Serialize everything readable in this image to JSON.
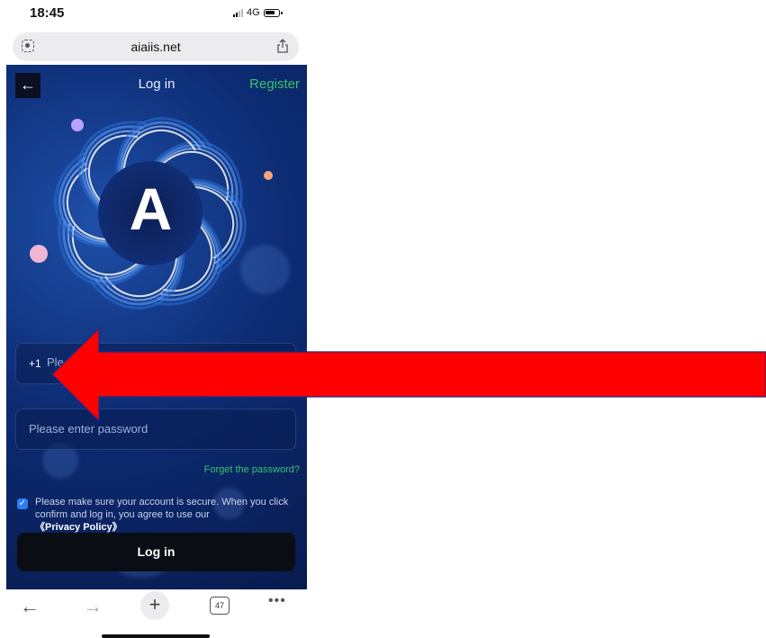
{
  "status_bar": {
    "time": "18:45",
    "network": "4G"
  },
  "browser": {
    "url": "aiaiis.net",
    "tab_count": "47",
    "icons": [
      "scan-icon",
      "share-icon",
      "back-arrow-icon",
      "forward-arrow-icon",
      "new-tab-plus-icon",
      "tabs-icon",
      "more-dots-icon"
    ],
    "more_label": "•••"
  },
  "header": {
    "back_icon": "←",
    "title": "Log in",
    "register": "Register"
  },
  "logo": {
    "letter": "A"
  },
  "form": {
    "country_code": "+1",
    "phone_placeholder_visible": "Ple",
    "password_placeholder": "Please enter password",
    "forget_password": "Forget the password?",
    "agreement_text": "Please make sure your account is secure. When you click confirm and log in, you agree to use our",
    "privacy_policy": "《Privacy Policy》",
    "agreement_checked": true,
    "login_button": "Log in"
  },
  "annotation": {
    "type": "red-arrow",
    "direction": "left",
    "color": "#ff0000"
  }
}
